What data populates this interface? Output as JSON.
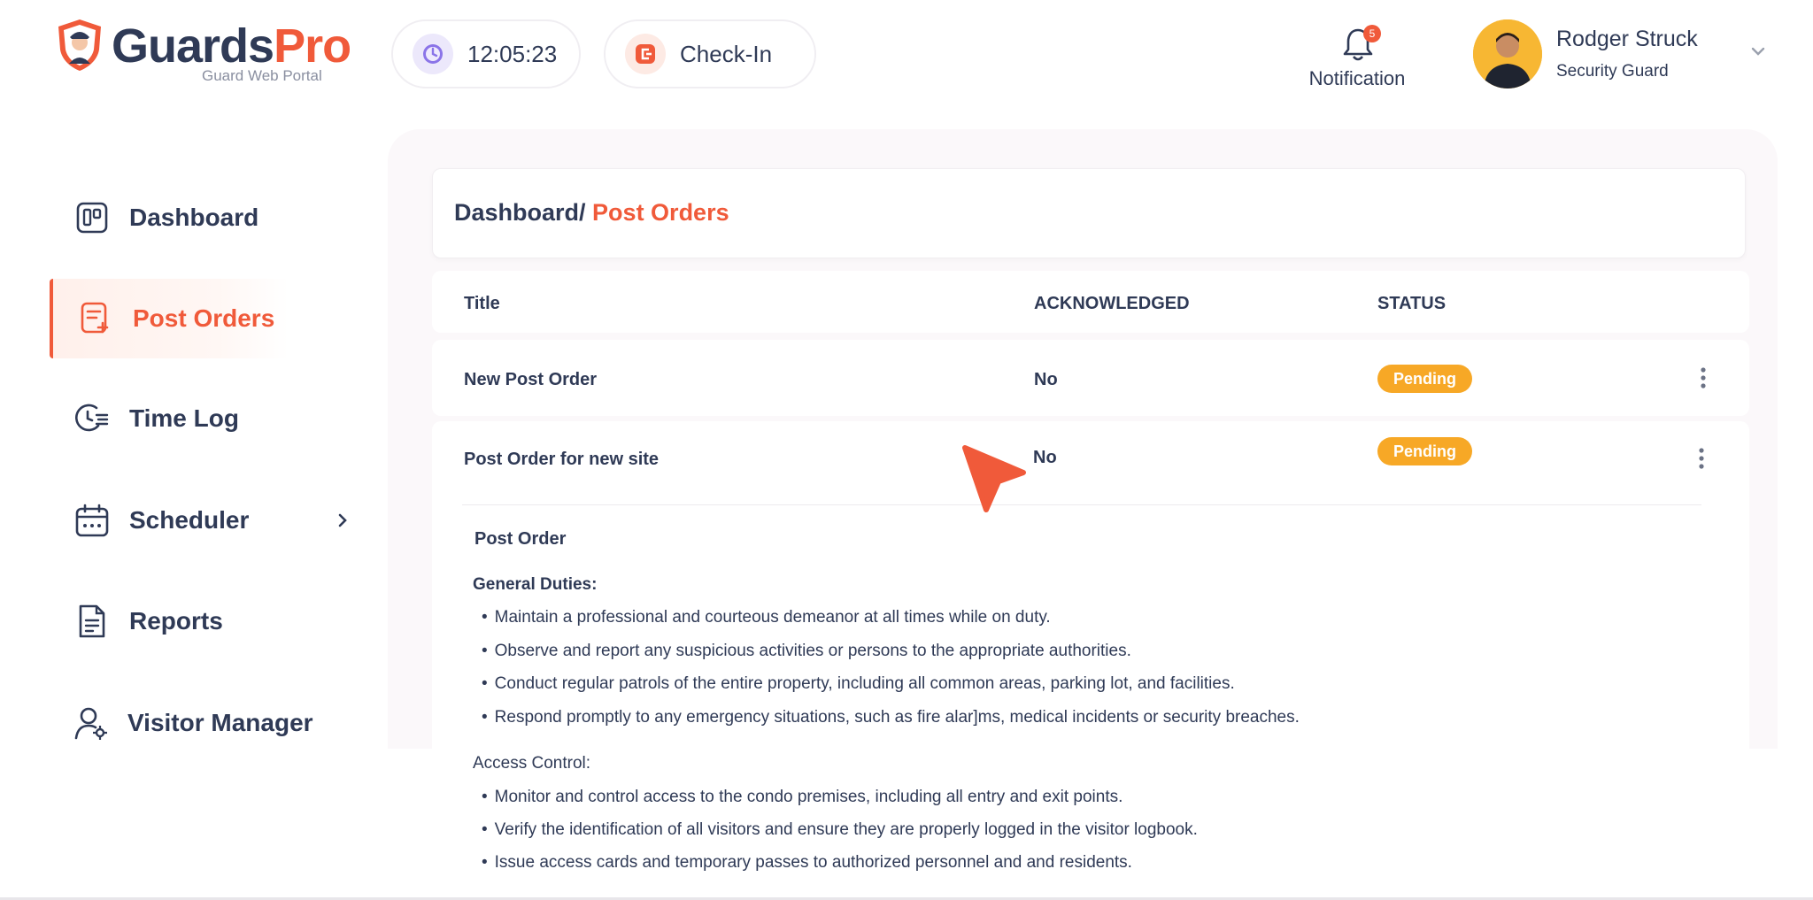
{
  "header": {
    "brand_main": "Guards",
    "brand_accent": "Pro",
    "brand_sub": "Guard Web Portal",
    "clock": "12:05:23",
    "checkin_label": "Check-In",
    "notification_label": "Notification",
    "notification_count": "5",
    "user_name": "Rodger Struck",
    "user_role": "Security Guard"
  },
  "sidebar": {
    "items": [
      {
        "label": "Dashboard",
        "icon": "dashboard-icon"
      },
      {
        "label": "Post Orders",
        "icon": "post-orders-icon",
        "active": true
      },
      {
        "label": "Time Log",
        "icon": "time-log-icon"
      },
      {
        "label": "Scheduler",
        "icon": "calendar-icon"
      },
      {
        "label": "Reports",
        "icon": "document-icon"
      },
      {
        "label": "Visitor Manager",
        "icon": "visitor-icon"
      }
    ]
  },
  "breadcrumb": {
    "root": "Dashboard/",
    "current": "Post Orders"
  },
  "table": {
    "headers": [
      "Title",
      "ACKNOWLEDGED",
      "STATUS"
    ],
    "rows": [
      {
        "title": "New Post Order",
        "acknowledged": "No",
        "status": "Pending"
      },
      {
        "title": "Post Order for new site",
        "acknowledged": "No",
        "status": "Pending"
      }
    ]
  },
  "detail": {
    "title": "Post Order",
    "sections": [
      {
        "heading": "General Duties:",
        "items": [
          "Maintain a professional and  courteous demeanor at all times while on duty.",
          "Observe and report any suspicious activities or persons to the appropriate authorities.",
          "Conduct regular patrols of the entire property, including all common areas, parking lot, and facilities.",
          "Respond promptly to any emergency situations, such as fire alar]ms, medical incidents or security breaches."
        ]
      },
      {
        "heading": "Access Control:",
        "items": [
          "Monitor and control access to the condo premises, including all entry and  exit points.",
          "Verify the identification of all visitors and ensure they are properly logged in the visitor logbook.",
          "Issue access cards and temporary passes to authorized personnel and and residents."
        ]
      }
    ]
  },
  "colors": {
    "accent": "#f05a3a",
    "navy": "#2f3a56",
    "pending": "#f7a826"
  }
}
